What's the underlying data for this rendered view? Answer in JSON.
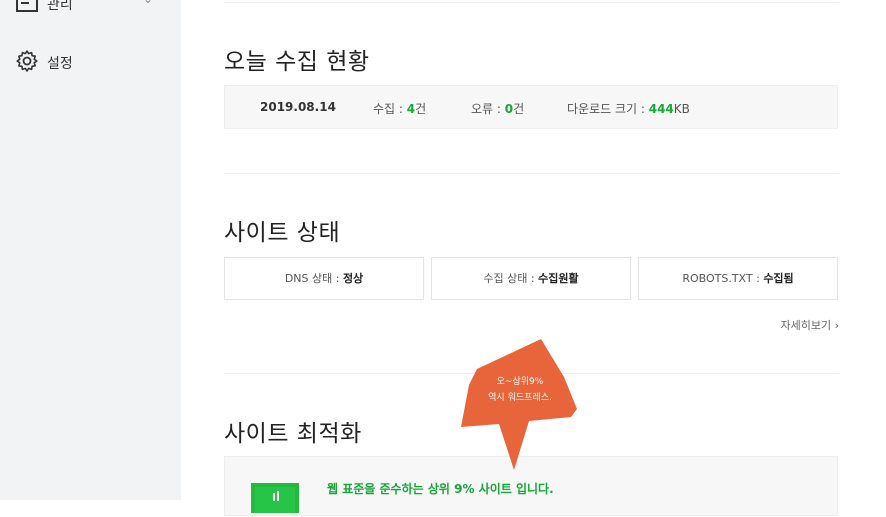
{
  "sidebar": {
    "items": [
      {
        "label": "관리",
        "icon": "folder-icon"
      },
      {
        "label": "설정",
        "icon": "gear-icon"
      }
    ]
  },
  "today": {
    "title": "오늘 수집 현황",
    "date": "2019.08.14",
    "collect_label": "수집 : ",
    "collect_value": "4",
    "collect_unit": "건",
    "error_label": "오류 : ",
    "error_value": "0",
    "error_unit": "건",
    "download_label": "다운로드 크기 : ",
    "download_value": "444",
    "download_unit": "KB"
  },
  "site_status": {
    "title": "사이트 상태",
    "boxes": [
      {
        "label": "DNS 상태 : ",
        "value": "정상"
      },
      {
        "label": "수집 상태 : ",
        "value": "수집원활"
      },
      {
        "label": "ROBOTS.TXT : ",
        "value": "수집됨"
      }
    ],
    "more_label": "자세히보기"
  },
  "optimization": {
    "title": "사이트 최적화",
    "message": "웹 표준을 준수하는 상위 9% 사이트 입니다.",
    "bubble_line1": "오~상위9%",
    "bubble_line2": "역시 워드프레스.",
    "bubble_color": "#e8643a",
    "accent": "#1fba3e"
  }
}
